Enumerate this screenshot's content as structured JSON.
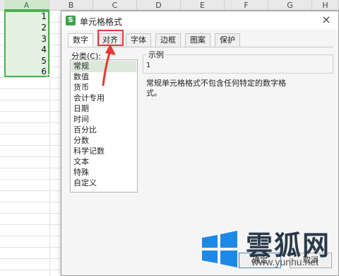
{
  "sheet": {
    "columns": [
      "A",
      "B",
      "C",
      "D",
      "E",
      "F",
      "G",
      "H"
    ],
    "selected_column": "A",
    "values": [
      "1",
      "2",
      "3",
      "4",
      "5",
      "6"
    ]
  },
  "dialog": {
    "title": "单元格格式",
    "app_icon_letter": "S",
    "close_symbol": "×",
    "tabs": [
      "数字",
      "对齐",
      "字体",
      "边框",
      "图案",
      "保护"
    ],
    "active_tab": "数字",
    "highlighted_tab": "对齐",
    "category_label": "分类(C):",
    "categories": [
      "常规",
      "数值",
      "货币",
      "会计专用",
      "日期",
      "时间",
      "百分比",
      "分数",
      "科学记数",
      "文本",
      "特殊",
      "自定义"
    ],
    "selected_category": "常规",
    "sample_title": "示例",
    "sample_value": "1",
    "description": "常规单元格格式不包含任何特定的数字格式。",
    "ok_label": "确定",
    "cancel_label": "取消"
  },
  "watermark": {
    "brand": "雲狐网",
    "url": "www.yunhu.net"
  },
  "colors": {
    "selection_green": "#4caf50",
    "highlight_red": "#e53935"
  }
}
